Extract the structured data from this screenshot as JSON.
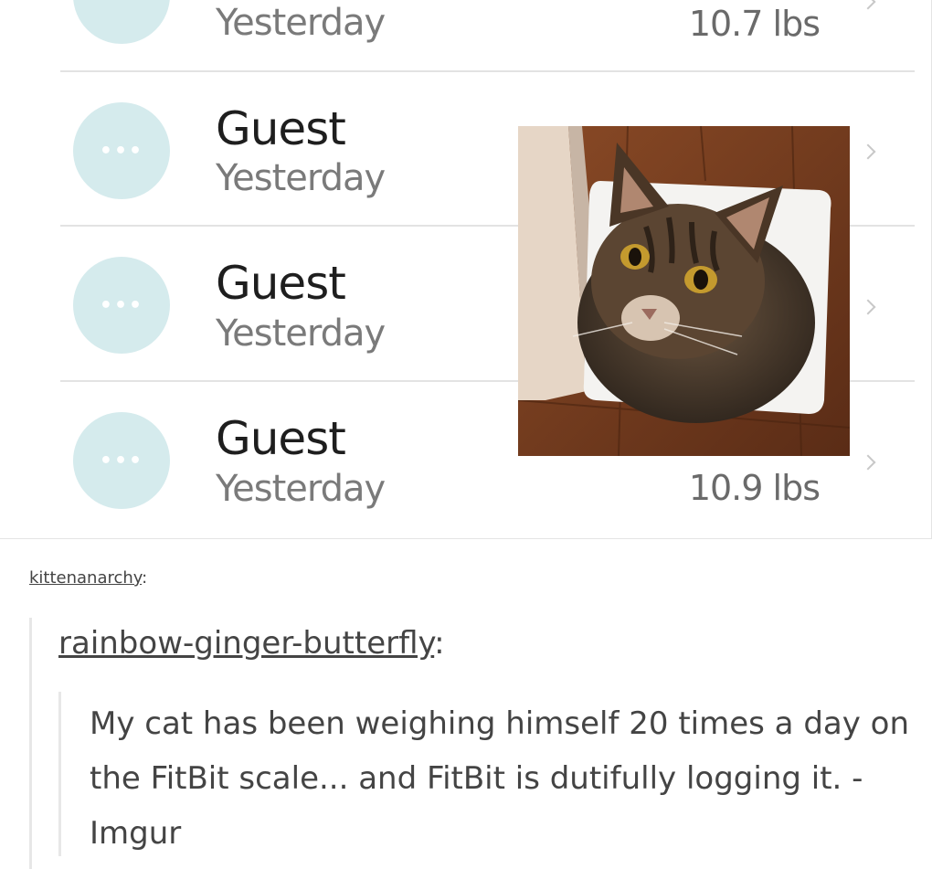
{
  "log": {
    "top_row": {
      "date": "Yesterday",
      "weight": "10.7 lbs"
    },
    "rows": [
      {
        "avatar_dots": "•••",
        "name": "Guest",
        "date": "Yesterday"
      },
      {
        "avatar_dots": "•••",
        "name": "Guest",
        "date": "Yesterday"
      },
      {
        "avatar_dots": "•••",
        "name": "Guest",
        "date": "Yesterday",
        "weight": "10.9 lbs"
      }
    ],
    "colors": {
      "avatar": "#d5ebed",
      "divider": "#e3e3e3"
    }
  },
  "post": {
    "reblogger": "kittenanarchy",
    "reblogger_suffix": ":",
    "original_poster": "rainbow-ginger-butterfly",
    "original_poster_suffix": ":",
    "body": "My cat has been weighing himself 20 times a day on the FitBit scale... and FitBit is dutifully logging it. - Imgur"
  }
}
